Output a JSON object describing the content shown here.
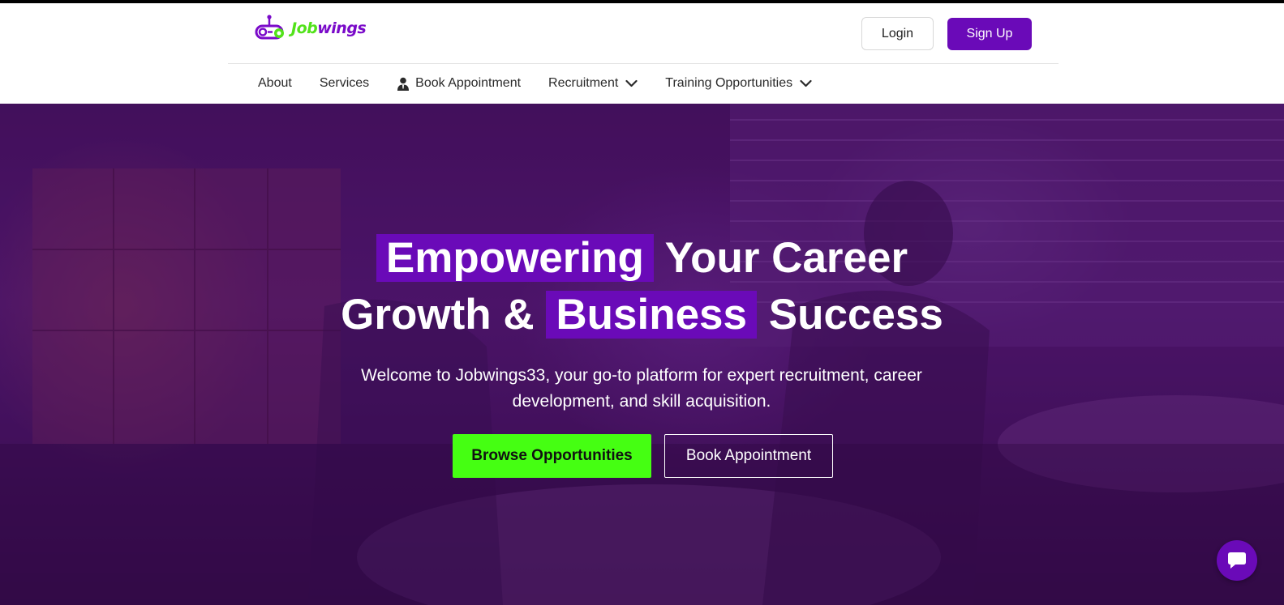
{
  "brand": {
    "logo_text_part1": "Job",
    "logo_text_part2": "wings",
    "primary_color": "#6a0ab8",
    "accent_color": "#45ff12"
  },
  "header": {
    "login_label": "Login",
    "signup_label": "Sign Up"
  },
  "nav": {
    "items": [
      {
        "label": "About",
        "icon": null,
        "has_dropdown": false
      },
      {
        "label": "Services",
        "icon": null,
        "has_dropdown": false
      },
      {
        "label": "Book Appointment",
        "icon": "person-icon",
        "has_dropdown": false
      },
      {
        "label": "Recruitment",
        "icon": null,
        "has_dropdown": true
      },
      {
        "label": "Training Opportunities",
        "icon": null,
        "has_dropdown": true
      }
    ]
  },
  "hero": {
    "headline_word1": "Empowering",
    "headline_rest1": " Your Career",
    "headline_word2": "Growth & ",
    "headline_word3": "Business",
    "headline_rest2": " Success",
    "subtext": "Welcome to Jobwings33, your go-to platform for expert recruitment, career development, and skill acquisition.",
    "browse_label": "Browse Opportunities",
    "book_label": "Book Appointment"
  },
  "chat": {
    "icon": "chat-icon"
  }
}
